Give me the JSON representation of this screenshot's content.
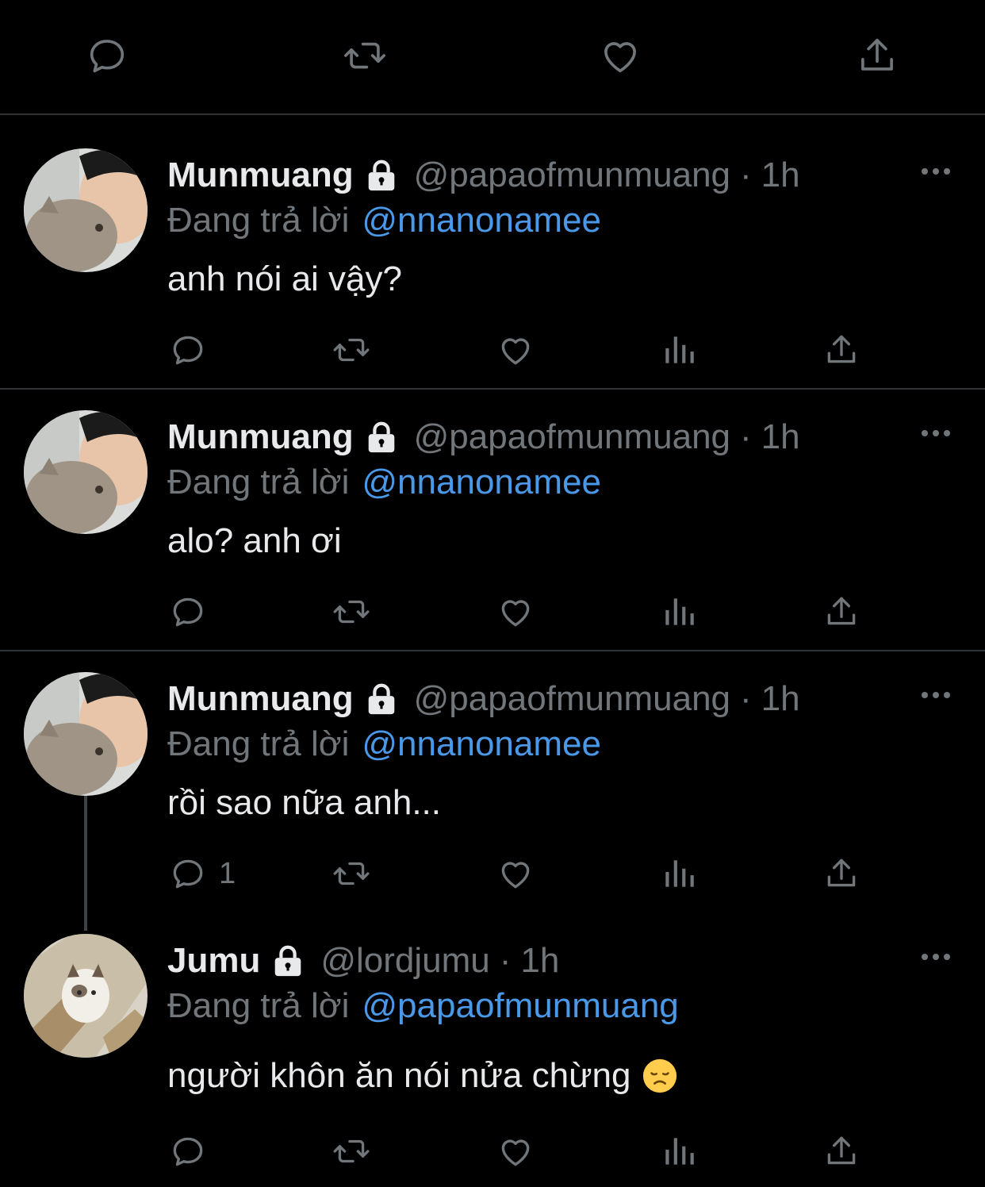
{
  "colors": {
    "background": "#000000",
    "divider": "#2f3336",
    "text_primary": "#e7e9ea",
    "text_secondary": "#71767b",
    "mention": "#4a99e9"
  },
  "top_actions": [
    "reply-icon",
    "retweet-icon",
    "like-icon",
    "share-icon"
  ],
  "tweets": [
    {
      "name": "Munmuang",
      "handle": "@papaofmunmuang",
      "separator": "·",
      "time": "1h",
      "reply_prefix": "Đang trả lời",
      "reply_to": "@nnanonamee",
      "text": "anh nói ai vậy?",
      "reply_count": ""
    },
    {
      "name": "Munmuang",
      "handle": "@papaofmunmuang",
      "separator": "·",
      "time": "1h",
      "reply_prefix": "Đang trả lời",
      "reply_to": "@nnanonamee",
      "text": "alo? anh ơi",
      "reply_count": ""
    },
    {
      "name": "Munmuang",
      "handle": "@papaofmunmuang",
      "separator": "·",
      "time": "1h",
      "reply_prefix": "Đang trả lời",
      "reply_to": "@nnanonamee",
      "text": "rồi sao nữa anh...",
      "reply_count": "1"
    },
    {
      "name": "Jumu",
      "handle": "@lordjumu",
      "separator": "·",
      "time": "1h",
      "reply_prefix": "Đang trả lời",
      "reply_to": "@papaofmunmuang",
      "text": "người khôn ăn nói nửa chừng",
      "emoji": "disappointed-face-emoji",
      "reply_count": ""
    }
  ]
}
